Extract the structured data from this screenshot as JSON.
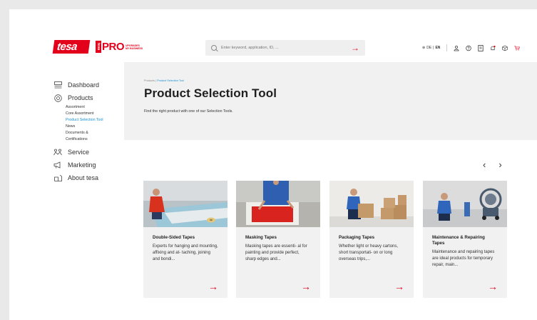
{
  "header": {
    "logo_text": "tesa",
    "logo_mini": "tesa",
    "logo_pro": "PRO",
    "logo_tagline_1": "UPGRADES",
    "logo_tagline_2": "MY BUSINESS",
    "search_placeholder": "Enter keyword, application, ID, ...",
    "lang_de": "DE",
    "lang_en": "EN",
    "accent": "#e3001b"
  },
  "sidebar": {
    "items": [
      {
        "label": "Dashboard",
        "icon": "dashboard-icon"
      },
      {
        "label": "Products",
        "icon": "products-icon"
      },
      {
        "label": "Service",
        "icon": "service-icon"
      },
      {
        "label": "Marketing",
        "icon": "megaphone-icon"
      },
      {
        "label": "About tesa",
        "icon": "about-icon"
      }
    ],
    "products_sub": [
      "Assortment",
      "Core Assortment",
      "Product Selection Tool",
      "News",
      "Documents & Certifications"
    ],
    "active_sub": "Product Selection Tool"
  },
  "main": {
    "breadcrumb_root": "Products",
    "breadcrumb_sep": "|",
    "breadcrumb_current": "Product Selection Tool",
    "title": "Product Selection Tool",
    "subtitle": "Find the right product with one of our Selection Tools.",
    "cards": [
      {
        "title": "Double-Sided Tapes",
        "text": "Experts for hanging and mounting, affixing and at- taching, joining and bondi..."
      },
      {
        "title": "Masking Tapes",
        "text": "Masking tapes are essenti- al for painting and provide perfect, sharp edges and..."
      },
      {
        "title": "Packaging Tapes",
        "text": "Whether light or heavy cartons, short transportati- on or long overseas trips,..."
      },
      {
        "title": "Maintenance & Repairing Tapes",
        "text": "Maintenance and repairing tapes are ideal products for temporary repair, main..."
      }
    ]
  }
}
